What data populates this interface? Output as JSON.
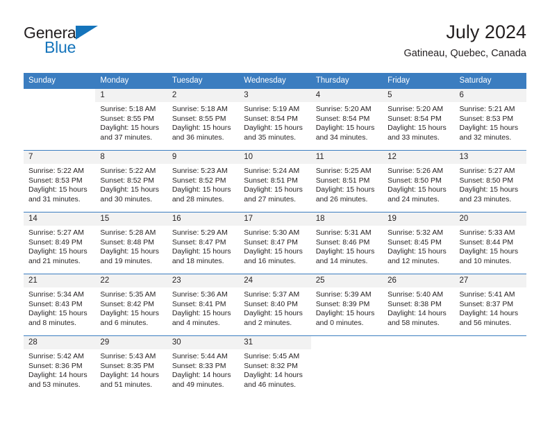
{
  "brand": {
    "name_part1": "General",
    "name_part2": "Blue",
    "accent_color": "#1574bb"
  },
  "header": {
    "title": "July 2024",
    "location": "Gatineau, Quebec, Canada"
  },
  "theme": {
    "header_bg": "#3b7dc0",
    "daynum_bg": "#f2f2f2",
    "text": "#231f20"
  },
  "weekday_headers": [
    "Sunday",
    "Monday",
    "Tuesday",
    "Wednesday",
    "Thursday",
    "Friday",
    "Saturday"
  ],
  "labels": {
    "sunrise_prefix": "Sunrise:",
    "sunset_prefix": "Sunset:",
    "daylight_prefix": "Daylight:"
  },
  "weeks": [
    [
      {
        "day": "",
        "line1": "",
        "line2": "",
        "line3": "",
        "line4": "",
        "empty": true
      },
      {
        "day": "1",
        "line1": "Sunrise: 5:18 AM",
        "line2": "Sunset: 8:55 PM",
        "line3": "Daylight: 15 hours",
        "line4": "and 37 minutes."
      },
      {
        "day": "2",
        "line1": "Sunrise: 5:18 AM",
        "line2": "Sunset: 8:55 PM",
        "line3": "Daylight: 15 hours",
        "line4": "and 36 minutes."
      },
      {
        "day": "3",
        "line1": "Sunrise: 5:19 AM",
        "line2": "Sunset: 8:54 PM",
        "line3": "Daylight: 15 hours",
        "line4": "and 35 minutes."
      },
      {
        "day": "4",
        "line1": "Sunrise: 5:20 AM",
        "line2": "Sunset: 8:54 PM",
        "line3": "Daylight: 15 hours",
        "line4": "and 34 minutes."
      },
      {
        "day": "5",
        "line1": "Sunrise: 5:20 AM",
        "line2": "Sunset: 8:54 PM",
        "line3": "Daylight: 15 hours",
        "line4": "and 33 minutes."
      },
      {
        "day": "6",
        "line1": "Sunrise: 5:21 AM",
        "line2": "Sunset: 8:53 PM",
        "line3": "Daylight: 15 hours",
        "line4": "and 32 minutes."
      }
    ],
    [
      {
        "day": "7",
        "line1": "Sunrise: 5:22 AM",
        "line2": "Sunset: 8:53 PM",
        "line3": "Daylight: 15 hours",
        "line4": "and 31 minutes."
      },
      {
        "day": "8",
        "line1": "Sunrise: 5:22 AM",
        "line2": "Sunset: 8:52 PM",
        "line3": "Daylight: 15 hours",
        "line4": "and 30 minutes."
      },
      {
        "day": "9",
        "line1": "Sunrise: 5:23 AM",
        "line2": "Sunset: 8:52 PM",
        "line3": "Daylight: 15 hours",
        "line4": "and 28 minutes."
      },
      {
        "day": "10",
        "line1": "Sunrise: 5:24 AM",
        "line2": "Sunset: 8:51 PM",
        "line3": "Daylight: 15 hours",
        "line4": "and 27 minutes."
      },
      {
        "day": "11",
        "line1": "Sunrise: 5:25 AM",
        "line2": "Sunset: 8:51 PM",
        "line3": "Daylight: 15 hours",
        "line4": "and 26 minutes."
      },
      {
        "day": "12",
        "line1": "Sunrise: 5:26 AM",
        "line2": "Sunset: 8:50 PM",
        "line3": "Daylight: 15 hours",
        "line4": "and 24 minutes."
      },
      {
        "day": "13",
        "line1": "Sunrise: 5:27 AM",
        "line2": "Sunset: 8:50 PM",
        "line3": "Daylight: 15 hours",
        "line4": "and 23 minutes."
      }
    ],
    [
      {
        "day": "14",
        "line1": "Sunrise: 5:27 AM",
        "line2": "Sunset: 8:49 PM",
        "line3": "Daylight: 15 hours",
        "line4": "and 21 minutes."
      },
      {
        "day": "15",
        "line1": "Sunrise: 5:28 AM",
        "line2": "Sunset: 8:48 PM",
        "line3": "Daylight: 15 hours",
        "line4": "and 19 minutes."
      },
      {
        "day": "16",
        "line1": "Sunrise: 5:29 AM",
        "line2": "Sunset: 8:47 PM",
        "line3": "Daylight: 15 hours",
        "line4": "and 18 minutes."
      },
      {
        "day": "17",
        "line1": "Sunrise: 5:30 AM",
        "line2": "Sunset: 8:47 PM",
        "line3": "Daylight: 15 hours",
        "line4": "and 16 minutes."
      },
      {
        "day": "18",
        "line1": "Sunrise: 5:31 AM",
        "line2": "Sunset: 8:46 PM",
        "line3": "Daylight: 15 hours",
        "line4": "and 14 minutes."
      },
      {
        "day": "19",
        "line1": "Sunrise: 5:32 AM",
        "line2": "Sunset: 8:45 PM",
        "line3": "Daylight: 15 hours",
        "line4": "and 12 minutes."
      },
      {
        "day": "20",
        "line1": "Sunrise: 5:33 AM",
        "line2": "Sunset: 8:44 PM",
        "line3": "Daylight: 15 hours",
        "line4": "and 10 minutes."
      }
    ],
    [
      {
        "day": "21",
        "line1": "Sunrise: 5:34 AM",
        "line2": "Sunset: 8:43 PM",
        "line3": "Daylight: 15 hours",
        "line4": "and 8 minutes."
      },
      {
        "day": "22",
        "line1": "Sunrise: 5:35 AM",
        "line2": "Sunset: 8:42 PM",
        "line3": "Daylight: 15 hours",
        "line4": "and 6 minutes."
      },
      {
        "day": "23",
        "line1": "Sunrise: 5:36 AM",
        "line2": "Sunset: 8:41 PM",
        "line3": "Daylight: 15 hours",
        "line4": "and 4 minutes."
      },
      {
        "day": "24",
        "line1": "Sunrise: 5:37 AM",
        "line2": "Sunset: 8:40 PM",
        "line3": "Daylight: 15 hours",
        "line4": "and 2 minutes."
      },
      {
        "day": "25",
        "line1": "Sunrise: 5:39 AM",
        "line2": "Sunset: 8:39 PM",
        "line3": "Daylight: 15 hours",
        "line4": "and 0 minutes."
      },
      {
        "day": "26",
        "line1": "Sunrise: 5:40 AM",
        "line2": "Sunset: 8:38 PM",
        "line3": "Daylight: 14 hours",
        "line4": "and 58 minutes."
      },
      {
        "day": "27",
        "line1": "Sunrise: 5:41 AM",
        "line2": "Sunset: 8:37 PM",
        "line3": "Daylight: 14 hours",
        "line4": "and 56 minutes."
      }
    ],
    [
      {
        "day": "28",
        "line1": "Sunrise: 5:42 AM",
        "line2": "Sunset: 8:36 PM",
        "line3": "Daylight: 14 hours",
        "line4": "and 53 minutes."
      },
      {
        "day": "29",
        "line1": "Sunrise: 5:43 AM",
        "line2": "Sunset: 8:35 PM",
        "line3": "Daylight: 14 hours",
        "line4": "and 51 minutes."
      },
      {
        "day": "30",
        "line1": "Sunrise: 5:44 AM",
        "line2": "Sunset: 8:33 PM",
        "line3": "Daylight: 14 hours",
        "line4": "and 49 minutes."
      },
      {
        "day": "31",
        "line1": "Sunrise: 5:45 AM",
        "line2": "Sunset: 8:32 PM",
        "line3": "Daylight: 14 hours",
        "line4": "and 46 minutes."
      },
      {
        "day": "",
        "line1": "",
        "line2": "",
        "line3": "",
        "line4": "",
        "empty": true
      },
      {
        "day": "",
        "line1": "",
        "line2": "",
        "line3": "",
        "line4": "",
        "empty": true
      },
      {
        "day": "",
        "line1": "",
        "line2": "",
        "line3": "",
        "line4": "",
        "empty": true
      }
    ]
  ]
}
